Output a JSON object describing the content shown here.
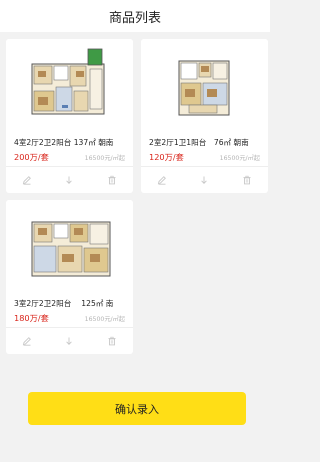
{
  "header": {
    "title": "商品列表"
  },
  "products": [
    {
      "title": "4室2厅2卫2阳台 137㎡ 朝南",
      "price": "200万/套",
      "unit_price": "16500元/㎡起"
    },
    {
      "title": "2室2厅1卫1阳台　76㎡ 朝南",
      "price": "120万/套",
      "unit_price": "16500元/㎡起"
    },
    {
      "title": "3室2厅2卫2阳台　 125㎡ 南",
      "price": "180万/套",
      "unit_price": "16500元/㎡起"
    }
  ],
  "icons": {
    "edit": "pencil-icon",
    "move": "arrow-down-icon",
    "delete": "trash-icon"
  },
  "colors": {
    "accent": "#ffde16",
    "price": "#d9261c",
    "background": "#f2f2f2"
  },
  "footer": {
    "confirm_label": "确认录入"
  }
}
